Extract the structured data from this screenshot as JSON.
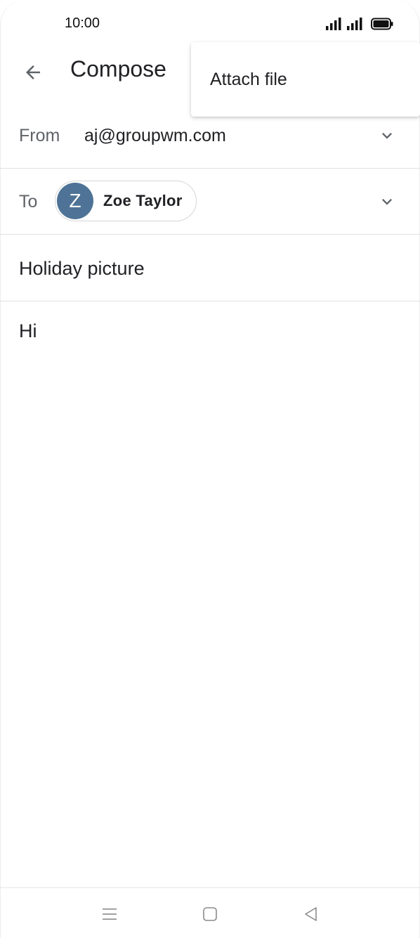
{
  "status_bar": {
    "time": "10:00",
    "icons": [
      "signal-icon",
      "signal-icon",
      "battery-icon"
    ]
  },
  "app_bar": {
    "back_icon": "arrow-back-icon",
    "title": "Compose"
  },
  "overflow_menu": {
    "items": [
      {
        "label": "Attach file"
      }
    ]
  },
  "compose": {
    "from": {
      "label": "From",
      "value": "aj@groupwm.com",
      "expand_icon": "chevron-down-icon"
    },
    "to": {
      "label": "To",
      "recipients": [
        {
          "initial": "Z",
          "name": "Zoe Taylor",
          "avatar_color": "#4e7396"
        }
      ],
      "expand_icon": "chevron-down-icon"
    },
    "subject": "Holiday picture",
    "body": "Hi"
  },
  "nav_bar": {
    "icons": [
      "recents-icon",
      "home-icon",
      "back-icon"
    ]
  },
  "colors": {
    "text_primary": "#202124",
    "text_secondary": "#5f6368",
    "divider": "#e0e0e0",
    "avatar": "#4e7396"
  }
}
